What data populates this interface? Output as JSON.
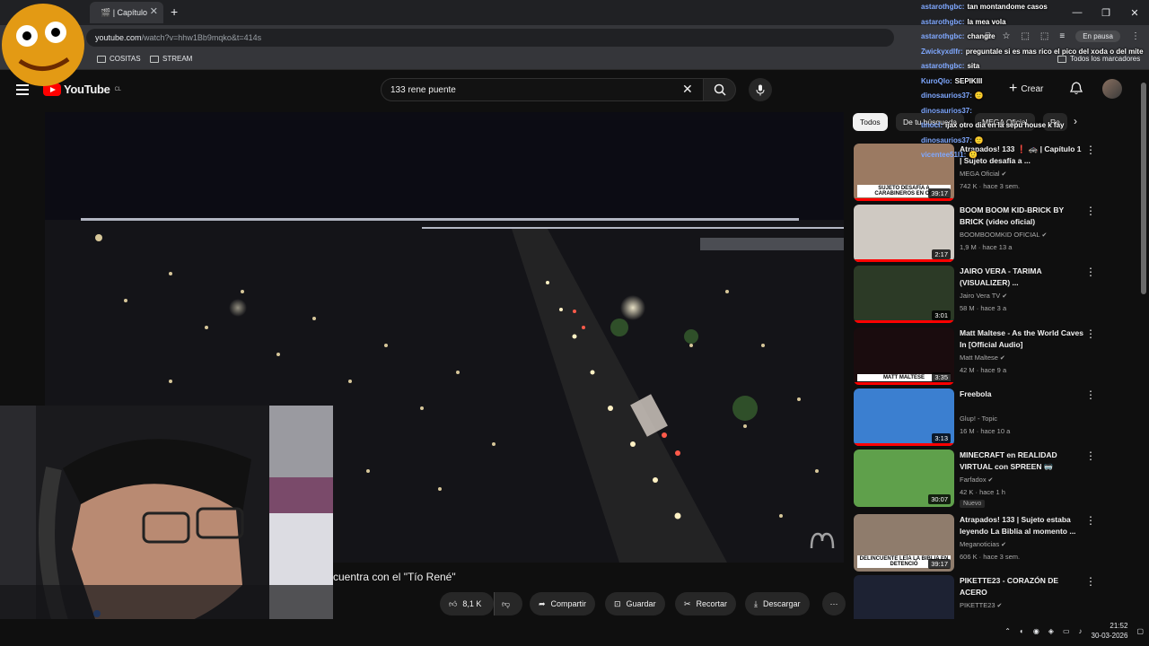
{
  "browser": {
    "tab_title": "🎬 | Capítulo",
    "url_host": "youtube.com",
    "url_rest": "/watch?v=hhw1Bb9mqko&t=414s",
    "paused_label": "En pausa",
    "bookmarks": [
      "COSITAS",
      "STREAM"
    ],
    "all_bookmarks": "Todos los marcadores"
  },
  "youtube": {
    "logo": "YouTube",
    "region": "CL",
    "search_query": "133 rene puente",
    "create_label": "Crear"
  },
  "video": {
    "title_visible": "cuentra con el \"Tío René\"",
    "likes": "8,1 K",
    "share": "Compartir",
    "save": "Guardar",
    "clip": "Recortar",
    "download": "Descargar"
  },
  "chips": [
    "Todos",
    "De tu búsqueda",
    "MEGA Oficial",
    "Re"
  ],
  "recommendations": [
    {
      "title": "Atrapados! 133 ❗ 🚓 | Capítulo 1 | Sujeto desafía a ...",
      "channel": "MEGA Oficial",
      "meta": "742 K · hace 3 sem.",
      "duration": "39:17",
      "thumb_text": "SUJETO DESAFÍA A CARABINEROS EN CO",
      "verified": true,
      "color": "#9b7a62",
      "progress": 1.0
    },
    {
      "title": "BOOM BOOM KID-BRICK BY BRICK (video oficial)",
      "channel": "BOOMBOOMKID OFICIAL",
      "meta": "1,9 M · hace 13 a",
      "duration": "2:17",
      "thumb_text": "",
      "verified": true,
      "color": "#cfc9c2",
      "progress": 1.0
    },
    {
      "title": "JAIRO VERA - TARIMA (VISUALIZER) ...",
      "channel": "Jairo Vera TV",
      "meta": "58 M · hace 3 a",
      "duration": "3:01",
      "thumb_text": "",
      "verified": true,
      "color": "#2c3a26",
      "progress": 1.0
    },
    {
      "title": "Matt Maltese - As the World Caves In [Official Audio]",
      "channel": "Matt Maltese",
      "meta": "42 M · hace 9 a",
      "duration": "3:35",
      "thumb_text": "MATT MALTESE",
      "verified": true,
      "color": "#1a0c0e",
      "progress": 1.0
    },
    {
      "title": "Freebola",
      "channel": "Glup! - Topic",
      "meta": "16 M · hace 10 a",
      "duration": "3:13",
      "thumb_text": "",
      "verified": false,
      "color": "#3b7fd0",
      "progress": 1.0
    },
    {
      "title": "MINECRAFT en REALIDAD VIRTUAL con SPREEN 🥽",
      "channel": "Farfadox",
      "meta": "42 K · hace 1 h",
      "duration": "30:07",
      "thumb_text": "",
      "verified": true,
      "color": "#5fa04b",
      "progress": 0,
      "badge": "Nuevo"
    },
    {
      "title": "Atrapados! 133 | Sujeto estaba leyendo La Biblia al momento ...",
      "channel": "Meganoticias",
      "meta": "606 K · hace 3 sem.",
      "duration": "39:17",
      "thumb_text": "DELINCUENTE LEÍA LA BIBLIA EN DETENCIÓ",
      "verified": true,
      "color": "#8f7c6c",
      "progress": 0
    },
    {
      "title": "PIKETTE23 - CORAZÓN DE ACERO",
      "channel": "PIKETTE23",
      "meta": "",
      "duration": "",
      "thumb_text": "",
      "verified": true,
      "color": "#1d2233",
      "progress": 0
    }
  ],
  "chat": [
    {
      "user": "astarothgbc:",
      "msg": "tan montandome casos"
    },
    {
      "user": "astarothgbc:",
      "msg": "la mea vola"
    },
    {
      "user": "astarothgbc:",
      "msg": "changre"
    },
    {
      "user": "Zwickyxdlfr:",
      "msg": "preguntale si es mas rico el pico del xoda o del mite"
    },
    {
      "user": "astarothgbc:",
      "msg": "sita"
    },
    {
      "user": "KuroQlo:",
      "msg": "SEPIKIII"
    },
    {
      "user": "dinosaurios37:",
      "msg": "🙂"
    },
    {
      "user": "dinosaurios37:",
      "msg": ""
    },
    {
      "user": "tinocl:",
      "msg": "ijax otro dia en la sepu house k fay"
    },
    {
      "user": "dinosaurios37:",
      "msg": "🙂"
    },
    {
      "user": "vicentee51l1:",
      "msg": "🙂"
    }
  ],
  "taskbar": {
    "time": "21:52",
    "date": "30-03-2026"
  }
}
